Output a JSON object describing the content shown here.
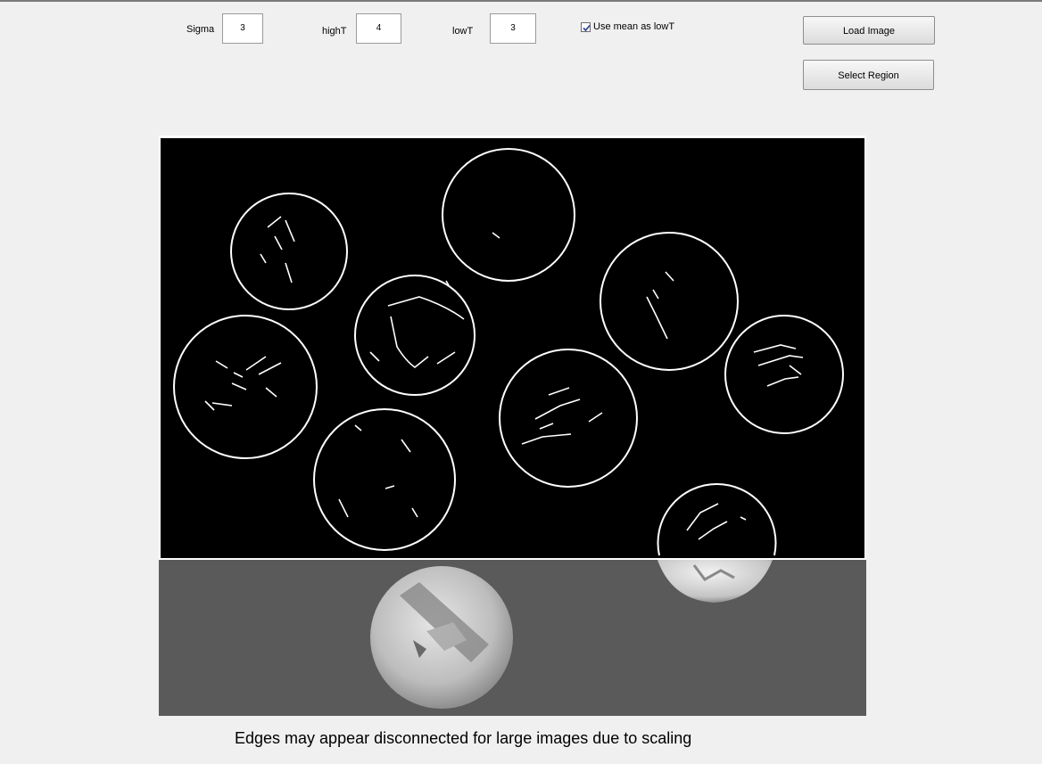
{
  "controls": {
    "sigma": {
      "label": "Sigma",
      "value": "3"
    },
    "highT": {
      "label": "highT",
      "value": "4"
    },
    "lowT": {
      "label": "lowT",
      "value": "3"
    },
    "use_mean": {
      "label": "Use mean as lowT",
      "checked": true
    }
  },
  "buttons": {
    "load_image": "Load Image",
    "select_region": "Select Region"
  },
  "footer_note": "Edges may appear disconnected for large images due to scaling",
  "colors": {
    "window_bg": "#f0f0f0",
    "edge_bg": "#000000",
    "edge_stroke": "#ffffff",
    "photo_bg": "#5a5a5a"
  }
}
